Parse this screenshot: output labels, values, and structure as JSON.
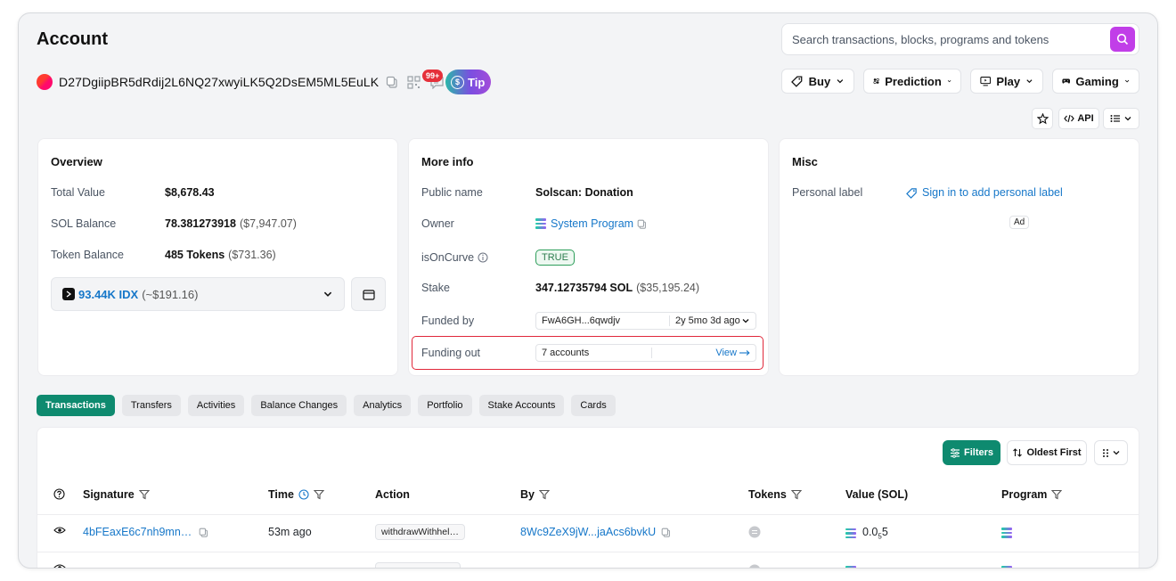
{
  "header": {
    "title": "Account",
    "search_placeholder": "Search transactions, blocks, programs and tokens"
  },
  "account": {
    "address": "D27DgiipBR5dRdij2L6NQ27xwyiLK5Q2DsEM5ML5EuLK",
    "notifications_badge": "99+",
    "tip_label": "Tip"
  },
  "top_nav": {
    "buy": "Buy",
    "prediction": "Prediction",
    "play": "Play",
    "gaming": "Gaming",
    "api": "API"
  },
  "overview": {
    "title": "Overview",
    "total_value_label": "Total Value",
    "total_value": "$8,678.43",
    "sol_balance_label": "SOL Balance",
    "sol_balance": "78.381273918",
    "sol_balance_usd": "($7,947.07)",
    "token_balance_label": "Token Balance",
    "token_balance": "485 Tokens",
    "token_balance_usd": "($731.36)",
    "token_select_value": "93.44K IDX",
    "token_select_usd": "(~$191.16)"
  },
  "more_info": {
    "title": "More info",
    "public_name_label": "Public name",
    "public_name": "Solscan: Donation",
    "owner_label": "Owner",
    "owner": "System Program",
    "is_on_curve_label": "isOnCurve",
    "is_on_curve": "TRUE",
    "stake_label": "Stake",
    "stake": "347.12735794 SOL",
    "stake_usd": "($35,195.24)",
    "funded_by_label": "Funded by",
    "funded_by_addr": "FwA6GH...6qwdjv",
    "funded_by_time": "2y 5mo 3d ago",
    "funding_out_label": "Funding out",
    "funding_out_count": "7 accounts",
    "funding_out_view": "View"
  },
  "misc": {
    "title": "Misc",
    "personal_label_label": "Personal label",
    "personal_label_link": "Sign in to add personal label",
    "ad": "Ad"
  },
  "tabs": [
    "Transactions",
    "Transfers",
    "Activities",
    "Balance Changes",
    "Analytics",
    "Portfolio",
    "Stake Accounts",
    "Cards"
  ],
  "table": {
    "filters_label": "Filters",
    "sort_label": "Oldest First",
    "columns": {
      "signature": "Signature",
      "time": "Time",
      "action": "Action",
      "by": "By",
      "tokens": "Tokens",
      "value": "Value (SOL)",
      "program": "Program"
    },
    "rows": [
      {
        "signature": "4bFEaxE6c7nh9mn…",
        "time": "53m ago",
        "action": "withdrawWithhel…",
        "by": "8Wc9ZeX9jW...jaAcs6bvkU",
        "value_main": "0.0",
        "value_sub": "5",
        "value_end": "5"
      }
    ]
  },
  "colors": {
    "accent_green": "#0e8a6f",
    "search_button": "#c13ee8",
    "link_blue": "#1677c9",
    "highlight_red": "#e0283a"
  }
}
